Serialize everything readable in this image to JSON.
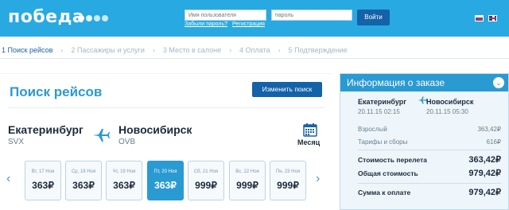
{
  "header": {
    "logo": "победа",
    "username_placeholder": "Имя пользователя",
    "password_placeholder": "пароль",
    "forgot_password": "Забыли пароль?",
    "register": "Регистрация",
    "login_button": "Войти",
    "languages": [
      "ru-flag",
      "en-flag"
    ]
  },
  "steps": [
    {
      "label": "1 Поиск рейсов",
      "active": true
    },
    {
      "label": "2 Пассажиры и услуги",
      "active": false
    },
    {
      "label": "3 Место в салоне",
      "active": false
    },
    {
      "label": "4 Оплата",
      "active": false
    },
    {
      "label": "5 Подтверждение",
      "active": false
    }
  ],
  "search": {
    "title": "Поиск рейсов",
    "change_button": "Изменить поиск",
    "from_city": "Екатеринбург",
    "from_code": "SVX",
    "to_city": "Новосибирск",
    "to_code": "OVB",
    "month_label": "Месяц",
    "days": [
      {
        "label": "Вт, 17 Ноя",
        "price": "363₽",
        "active": false
      },
      {
        "label": "Ср, 18 Ноя",
        "price": "363₽",
        "active": false
      },
      {
        "label": "Чт, 19 Ноя",
        "price": "363₽",
        "active": false
      },
      {
        "label": "Пт, 20 Ноя",
        "price": "363₽",
        "active": true
      },
      {
        "label": "Сб, 21 Ноя",
        "price": "999₽",
        "active": false
      },
      {
        "label": "Вс, 22 Ноя",
        "price": "999₽",
        "active": false
      },
      {
        "label": "Пн, 23 Ноя",
        "price": "999₽",
        "active": false
      }
    ]
  },
  "order_info": {
    "title": "Информация о заказе",
    "from": "Екатеринбург",
    "to": "Новосибирск",
    "from_datetime": "20.11.15 02:15",
    "to_datetime": "20.11.15 05:30",
    "adult_label": "Взрослый",
    "adult_value": "363,42₽",
    "tax_label": "Тарифы и сборы",
    "tax_value": "616₽",
    "flight_cost_label": "Стоимость перелета",
    "flight_cost_value": "363,42₽",
    "total_label": "Общая стоимость",
    "total_value": "979,42₽",
    "pay_label": "Сумма к оплате",
    "pay_value": "979,42₽"
  },
  "colors": {
    "brand": "#28a9e2",
    "button": "#1462a8",
    "accent": "#2a9ad2"
  }
}
